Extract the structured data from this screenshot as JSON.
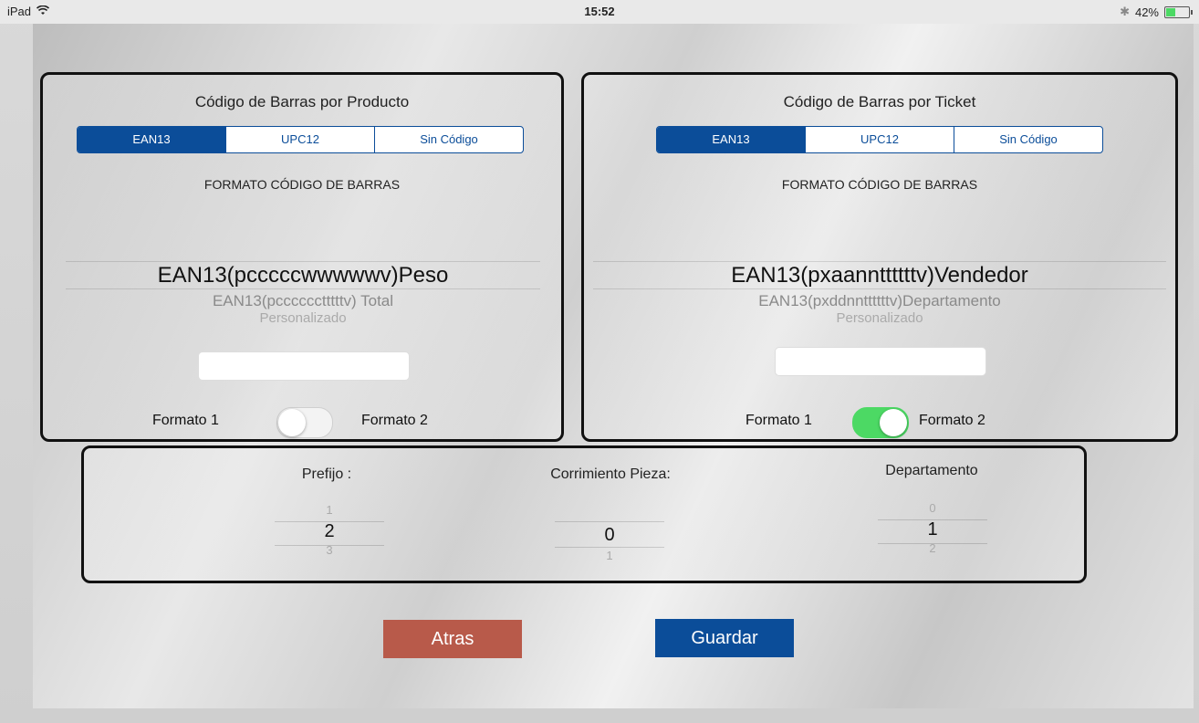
{
  "status_bar": {
    "device": "iPad",
    "time": "15:52",
    "battery": "42%"
  },
  "product_panel": {
    "title": "Código de Barras por Producto",
    "segments": [
      "EAN13",
      "UPC12",
      "Sin Código"
    ],
    "selected_segment": "EAN13",
    "format_label": "FORMATO CÓDIGO DE BARRAS",
    "picker_selected": "EAN13(pcccccwwwwwv)Peso",
    "picker_next": "EAN13(pcccccctttttv) Total",
    "picker_next2": "Personalizado",
    "input_value": "",
    "toggle_left": "Formato 1",
    "toggle_right": "Formato 2",
    "toggle_on": false
  },
  "ticket_panel": {
    "title": "Código de Barras por Ticket",
    "segments": [
      "EAN13",
      "UPC12",
      "Sin Código"
    ],
    "selected_segment": "EAN13",
    "format_label": "FORMATO CÓDIGO DE BARRAS",
    "picker_selected": "EAN13(pxaannttttttv)Vendedor",
    "picker_next": "EAN13(pxddnnttttttv)Departamento",
    "picker_next2": "Personalizado",
    "input_value": "",
    "toggle_left": "Formato 1",
    "toggle_right": "Formato 2",
    "toggle_on": true
  },
  "settings_panel": {
    "prefijo": {
      "label": "Prefijo :",
      "prev": "1",
      "selected": "2",
      "next": "3"
    },
    "corrimiento": {
      "label": "Corrimiento Pieza:",
      "prev": "",
      "selected": "0",
      "next": "1"
    },
    "departamento": {
      "label": "Departamento",
      "prev": "0",
      "selected": "1",
      "next": "2"
    }
  },
  "buttons": {
    "back": "Atras",
    "save": "Guardar"
  },
  "colors": {
    "accent": "#0b4d99",
    "back_button": "#b85a4a",
    "toggle_on": "#4cd964"
  }
}
